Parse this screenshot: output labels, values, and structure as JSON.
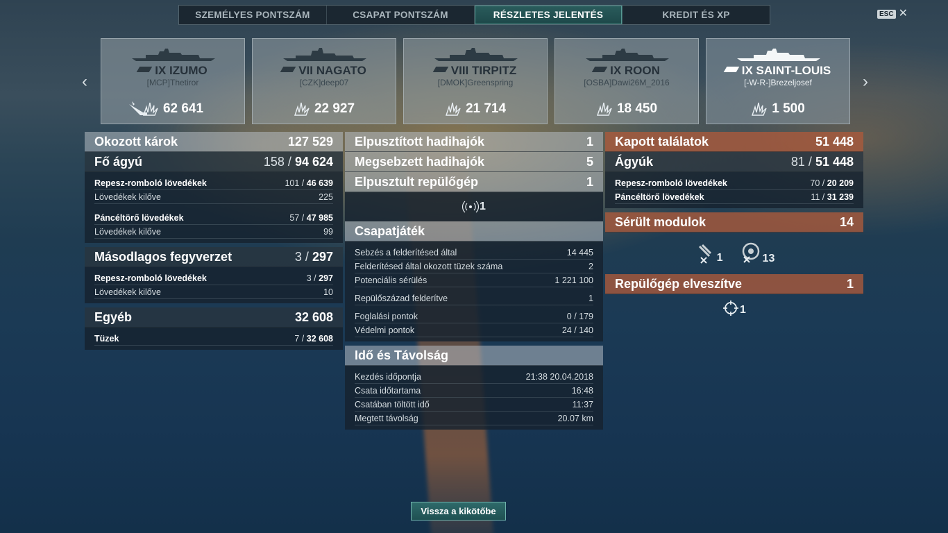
{
  "tabs": [
    "SZEMÉLYES PONTSZÁM",
    "CSAPAT PONTSZÁM",
    "RÉSZLETES JELENTÉS",
    "KREDIT ÉS XP"
  ],
  "active_tab": 2,
  "esc": {
    "key": "ESC",
    "close": "✕"
  },
  "ships": [
    {
      "name": "IX IZUMO",
      "player": "[MCP]Thetiror",
      "score": "62 641",
      "sunk": true,
      "own": false
    },
    {
      "name": "VII NAGATO",
      "player": "[CZK]deep07",
      "score": "22 927",
      "sunk": false,
      "own": false
    },
    {
      "name": "VIII TIRPITZ",
      "player": "[DMOK]Greenspring",
      "score": "21 714",
      "sunk": false,
      "own": false
    },
    {
      "name": "IX ROON",
      "player": "[OSBA]Dawi26M_2016",
      "score": "18 450",
      "sunk": false,
      "own": false
    },
    {
      "name": "IX SAINT-LOUIS",
      "player": "[-W-R-]Brezeljosef",
      "score": "1 500",
      "sunk": false,
      "own": true
    }
  ],
  "damage": {
    "title": "Okozott károk",
    "total": "127 529",
    "main": {
      "title": "Fő ágyú",
      "hits": "158 /",
      "dmg": "94 624"
    },
    "he": {
      "label": "Repesz-romboló lövedékek",
      "hits": "101 /",
      "dmg": "46 639"
    },
    "he_fired": {
      "label": "Lövedékek kilőve",
      "val": "225"
    },
    "ap": {
      "label": "Páncéltörő lövedékek",
      "hits": "57 /",
      "dmg": "47 985"
    },
    "ap_fired": {
      "label": "Lövedékek kilőve",
      "val": "99"
    },
    "secondary": {
      "title": "Másodlagos fegyverzet",
      "hits": "3 /",
      "dmg": "297"
    },
    "sec_he": {
      "label": "Repesz-romboló lövedékek",
      "hits": "3 /",
      "dmg": "297"
    },
    "sec_fired": {
      "label": "Lövedékek kilőve",
      "val": "10"
    },
    "other": {
      "title": "Egyéb",
      "total": "32 608"
    },
    "fires": {
      "label": "Tüzek",
      "hits": "7 /",
      "dmg": "32 608"
    }
  },
  "kills": {
    "destroyed": {
      "label": "Elpusztított hadihajók",
      "val": "1"
    },
    "damaged": {
      "label": "Megsebzett hadihajók",
      "val": "5"
    },
    "planes": {
      "label": "Elpusztult repülőgép",
      "val": "1"
    },
    "radio_count": "1"
  },
  "team": {
    "title": "Csapatjáték",
    "rows": [
      {
        "label": "Sebzés a felderítésed által",
        "val": "14 445"
      },
      {
        "label": "Felderítésed által okozott tüzek száma",
        "val": "2"
      },
      {
        "label": "Potenciális sérülés",
        "val": "1 221 100"
      },
      {
        "label": "Repülőszázad felderítve",
        "val": "1"
      },
      {
        "label": "Foglalási pontok",
        "val": "0 / 179"
      },
      {
        "label": "Védelmi pontok",
        "val": "24 / 140"
      }
    ]
  },
  "time": {
    "title": "Idő és Távolság",
    "rows": [
      {
        "label": "Kezdés időpontja",
        "val": "21:38  20.04.2018"
      },
      {
        "label": "Csata időtartama",
        "val": "16:48"
      },
      {
        "label": "Csatában töltött idő",
        "val": "11:37"
      },
      {
        "label": "Megtett távolság",
        "val": "20.07 km"
      }
    ]
  },
  "received": {
    "title": "Kapott találatok",
    "total": "51 448",
    "guns": {
      "title": "Ágyúk",
      "hits": "81 /",
      "dmg": "51 448"
    },
    "he": {
      "label": "Repesz-romboló lövedékek",
      "hits": "70 /",
      "dmg": "20 209"
    },
    "ap": {
      "label": "Páncéltörő lövedékek",
      "hits": "11 /",
      "dmg": "31 239"
    },
    "modules": {
      "title": "Sérült modulok",
      "total": "14"
    },
    "module_a": "1",
    "module_b": "13",
    "planes_lost": {
      "title": "Repülőgép elveszítve",
      "val": "1"
    },
    "planes_icon_count": "1"
  },
  "back_button": "Vissza a kikötőbe"
}
